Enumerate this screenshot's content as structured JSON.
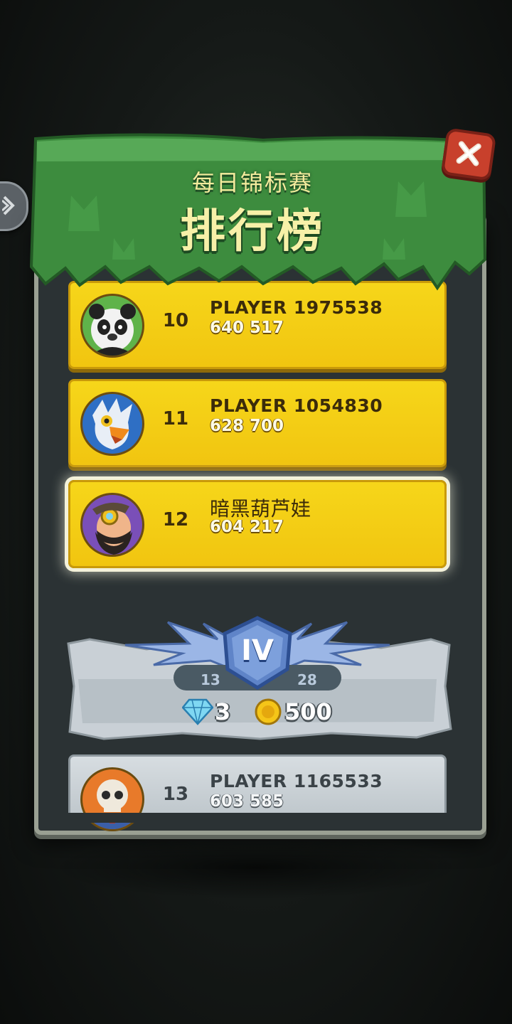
{
  "header": {
    "subtitle": "每日锦标赛",
    "title": "排行榜"
  },
  "controls": {
    "close_icon": "close-x-icon",
    "side_tab_icon": "chevron-right-icon"
  },
  "leaderboard": {
    "rows": [
      {
        "rank": "10",
        "name": "PLAYER 1975538",
        "score": "640 517",
        "avatar": "panda-avatar",
        "style": "gold"
      },
      {
        "rank": "11",
        "name": "PLAYER 1054830",
        "score": "628 700",
        "avatar": "eagle-avatar",
        "style": "gold"
      },
      {
        "rank": "12",
        "name": "暗黑葫芦娃",
        "score": "604 217",
        "avatar": "dwarf-avatar",
        "style": "gold-highlight"
      },
      {
        "rank": "13",
        "name": "PLAYER 1165533",
        "score": "603 585",
        "avatar": "skull-avatar",
        "style": "gray"
      }
    ]
  },
  "tier_divider": {
    "tier": "IV",
    "range_start": "13",
    "range_end": "28",
    "reward_gems": "3",
    "reward_coins": "500",
    "gem_icon": "diamond-icon",
    "coin_icon": "coin-icon"
  },
  "colors": {
    "row_gold": "#f4d015",
    "row_gray": "#cdd4d8",
    "banner_green": "#3e8f3f",
    "close_red": "#c8402c",
    "tier_blue": "#6b8fd0"
  }
}
